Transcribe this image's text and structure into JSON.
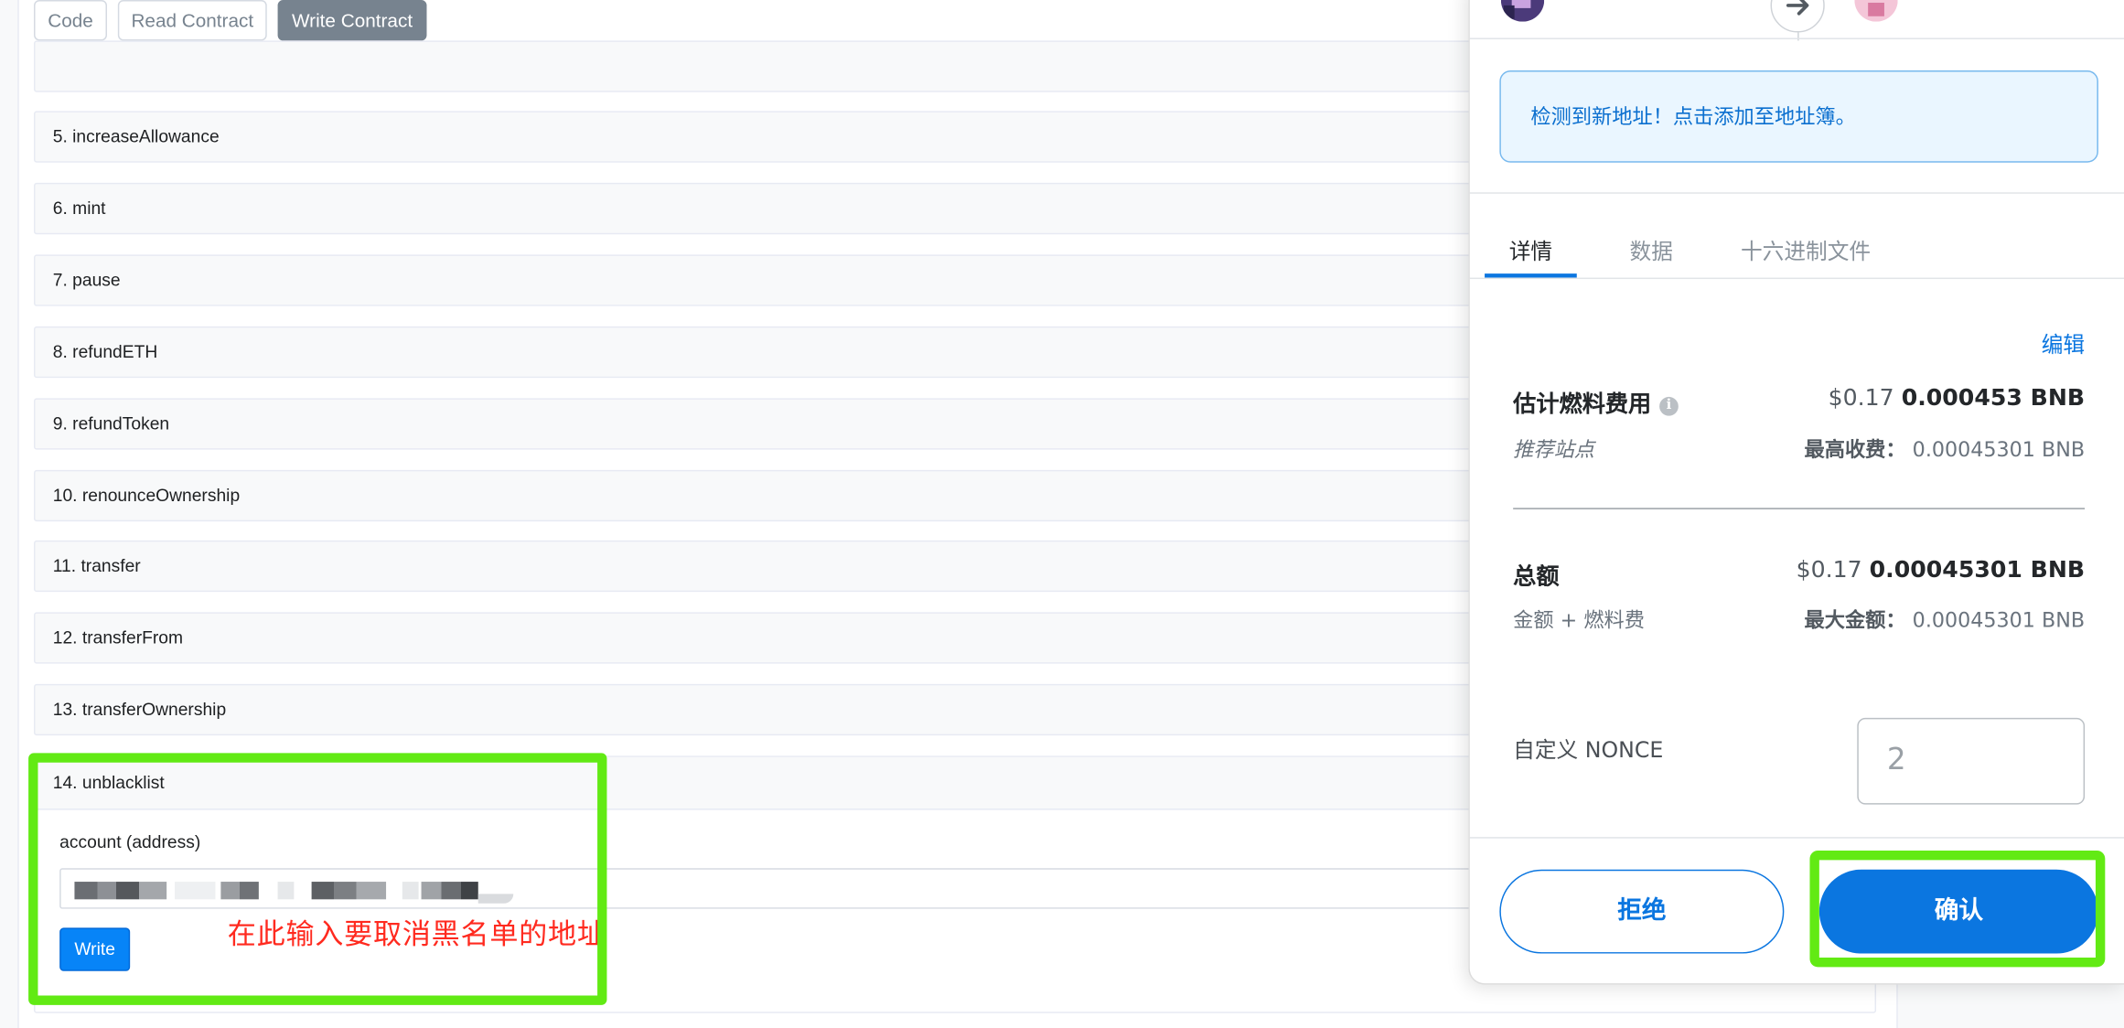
{
  "tabs": {
    "code": "Code",
    "read_contract": "Read Contract",
    "write_contract": "Write Contract"
  },
  "functions": [
    "5. increaseAllowance",
    "6. mint",
    "7. pause",
    "8. refundETH",
    "9. refundToken",
    "10. renounceOwnership",
    "11. transfer",
    "12. transferFrom",
    "13. transferOwnership"
  ],
  "unblacklist": {
    "title": "14. unblacklist",
    "param_label": "account (address)",
    "write_label": "Write"
  },
  "annotation": "在此输入要取消黑名单的地址",
  "wallet": {
    "alert": "检测到新地址！点击添加至地址簿。",
    "tabs": [
      "详情",
      "数据",
      "十六进制文件"
    ],
    "edit": "编辑",
    "gas": {
      "label": "估计燃料费用",
      "fiat": "$0.17",
      "amount": "0.000453 BNB",
      "site_hint": "推荐站点",
      "max_label": "最高收费：",
      "max_value": "0.00045301 BNB"
    },
    "total": {
      "label": "总额",
      "fiat": "$0.17",
      "amount": "0.00045301 BNB",
      "sub": "金额 + 燃料费",
      "max_label": "最大金额：",
      "max_value": "0.00045301 BNB"
    },
    "nonce_label": "自定义 NONCE",
    "nonce_value": "2",
    "reject": "拒绝",
    "confirm": "确认"
  },
  "colors": {
    "highlight": "#62ea14",
    "annotation": "#ff2a1f",
    "wallet_blue": "#0b76e0",
    "write_button": "#0784f7"
  },
  "icons": [
    "info-icon",
    "arrow-right-icon",
    "account-avatar-icon"
  ]
}
